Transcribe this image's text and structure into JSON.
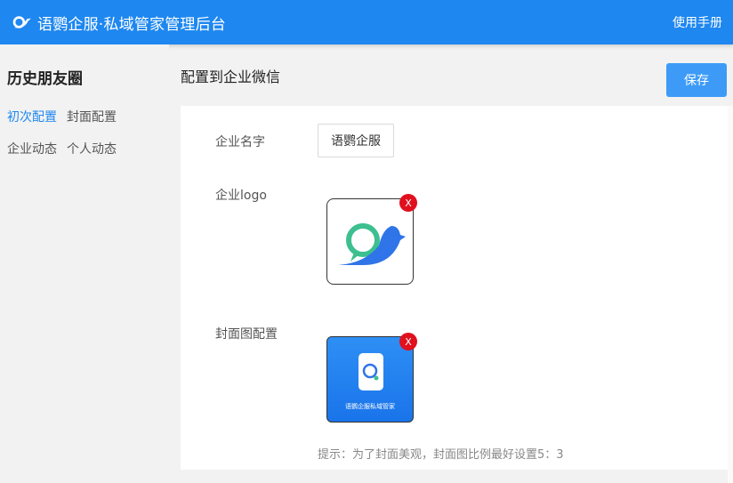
{
  "header": {
    "title": "语鹦企服·私域管家管理后台",
    "manual_label": "使用手册",
    "logo_icon": "parrot-logo-icon",
    "bg_color": "#1e87f0"
  },
  "sidebar": {
    "title": "历史朋友圈",
    "items": [
      {
        "label": "初次配置",
        "active": true
      },
      {
        "label": "封面配置",
        "active": false
      },
      {
        "label": "企业动态",
        "active": false
      },
      {
        "label": "个人动态",
        "active": false
      }
    ],
    "active_color": "#1e87f0"
  },
  "main": {
    "title": "配置到企业微信",
    "save_label": "保存",
    "fields": {
      "company_name_label": "企业名字",
      "company_name_value": "语鹦企服",
      "logo_label": "企业logo",
      "cover_label": "封面图配置"
    },
    "remove_label": "X",
    "cover_image_text": "语鹦企服私域管家",
    "hint": "提示：为了封面美观，封面图比例最好设置5：3"
  }
}
